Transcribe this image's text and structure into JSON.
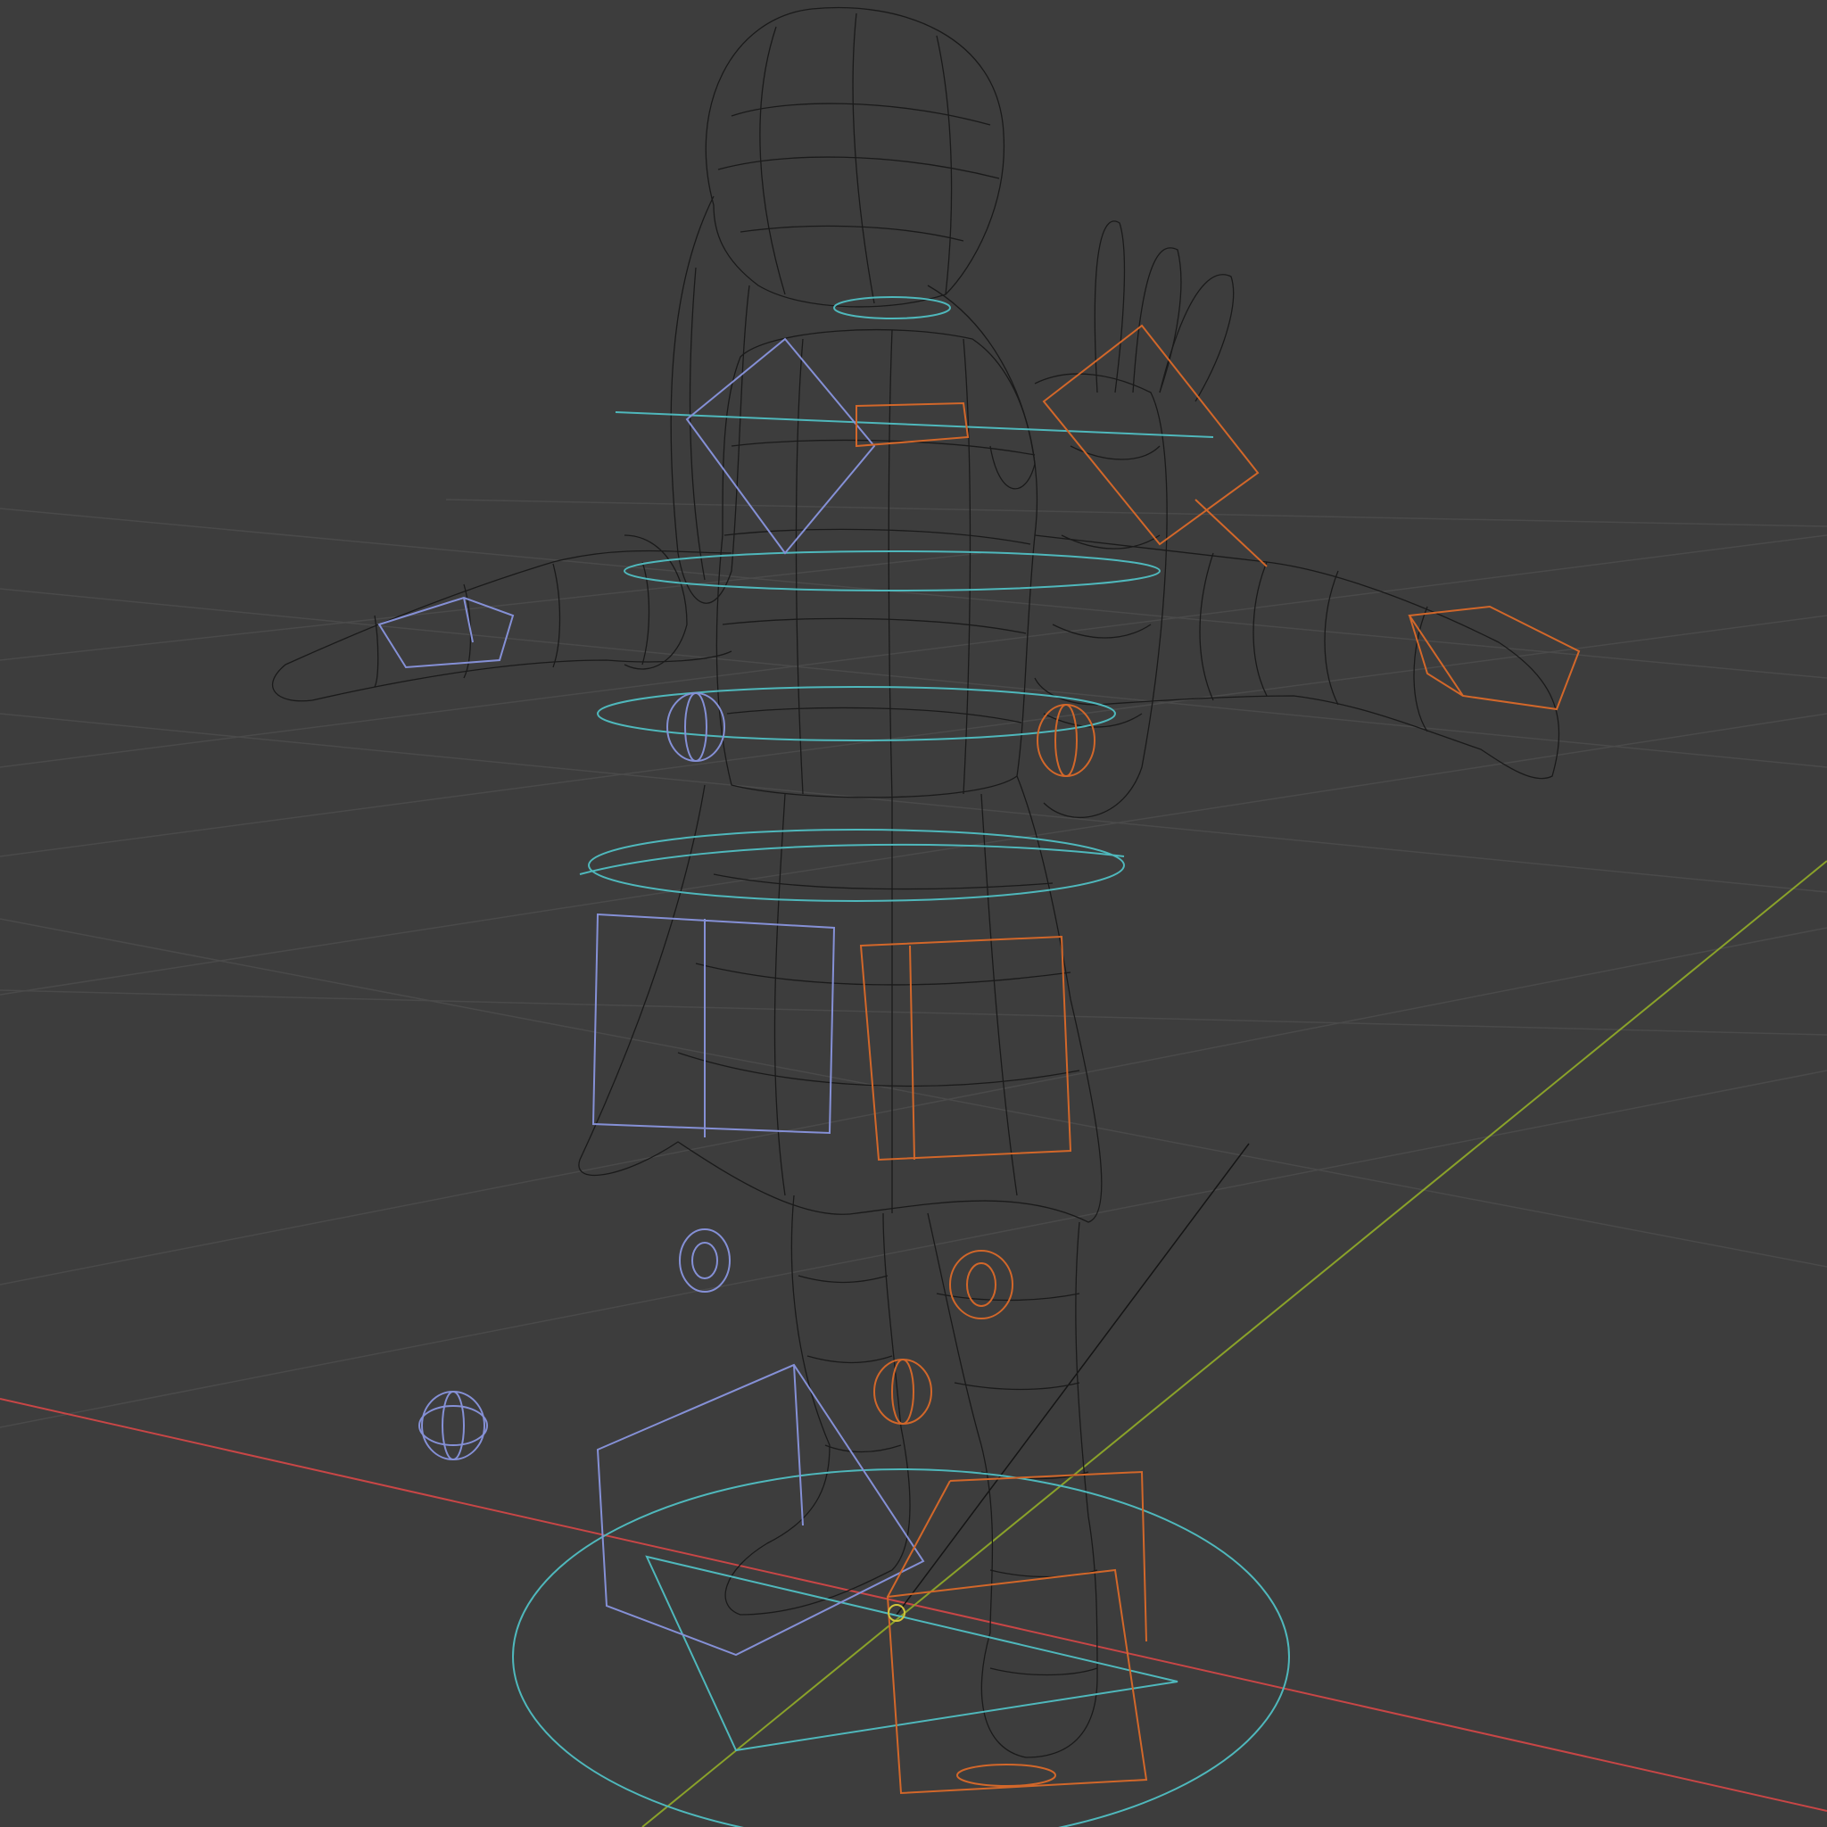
{
  "viewport": {
    "shading_mode": "wireframe",
    "view": "perspective",
    "background_color": "#3d3d3d",
    "grid_color": "#4a4a4a",
    "axis_x_color": "#c84646",
    "axis_y_color": "#8aa22a",
    "mesh_wire_color": "#1a1a1a"
  },
  "rig": {
    "left_side_color": "#8590d6",
    "right_side_color": "#d2672a",
    "center_color": "#4fb8bc",
    "controllers": [
      "root-control",
      "hip-control",
      "waist-control",
      "chest-control",
      "neck-control",
      "head-control",
      "left-shoulder-control",
      "right-shoulder-control",
      "left-hand-control",
      "right-hand-control",
      "left-elbow-pole",
      "right-elbow-pole",
      "left-thigh-control",
      "right-thigh-control",
      "left-knee-pole",
      "right-knee-pole",
      "left-foot-control",
      "right-foot-control"
    ]
  }
}
